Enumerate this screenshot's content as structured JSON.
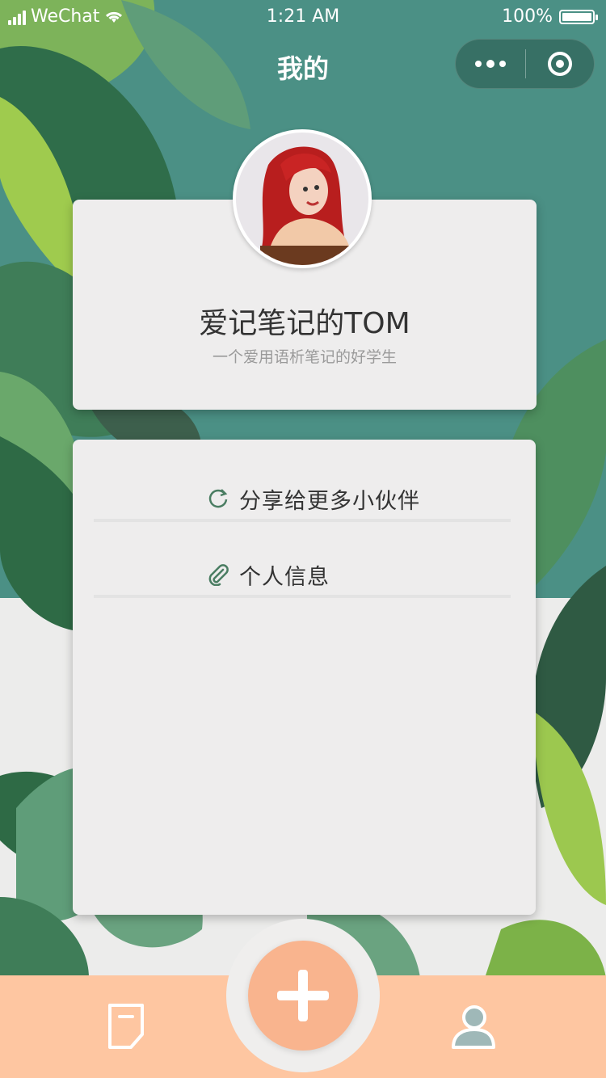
{
  "status_bar": {
    "carrier": "WeChat",
    "time": "1:21 AM",
    "battery": "100%"
  },
  "nav": {
    "title": "我的"
  },
  "profile": {
    "name": "爱记笔记的TOM",
    "bio": "一个爱用语析笔记的好学生"
  },
  "menu": {
    "items": [
      {
        "label": "分享给更多小伙伴",
        "icon": "refresh-icon"
      },
      {
        "label": "个人信息",
        "icon": "paperclip-icon"
      }
    ]
  },
  "tabbar": {
    "items": [
      {
        "icon": "note-icon"
      },
      {
        "icon": "plus-icon"
      },
      {
        "icon": "user-icon"
      }
    ]
  },
  "colors": {
    "background_green": "#4a8f84",
    "card": "#eeeded",
    "tabbar": "#fec6a1",
    "add_button": "#f9b48e"
  }
}
